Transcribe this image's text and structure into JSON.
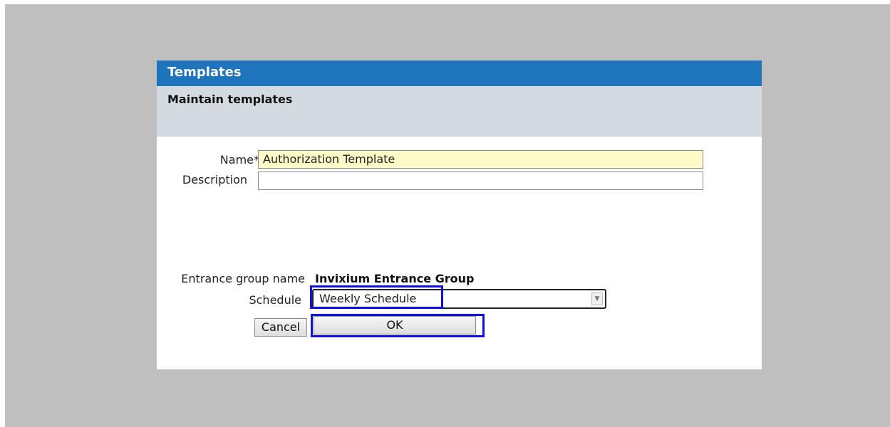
{
  "dialog": {
    "title": "Templates",
    "subtitle": "Maintain templates"
  },
  "form": {
    "name_label": "Name*",
    "name_value": "Authorization Template",
    "description_label": "Description",
    "description_value": "",
    "entrance_group_label": "Entrance group name",
    "entrance_group_value": "Invixium Entrance Group",
    "schedule_label": "Schedule",
    "schedule_value": "Weekly Schedule",
    "schedule_arrow_icon": "dropdown-arrow-icon"
  },
  "buttons": {
    "cancel_label": "Cancel",
    "ok_label": "OK"
  },
  "colors": {
    "titlebar": "#1f74be",
    "subheader": "#d3dbe1",
    "overlay": "#bfbfbf",
    "required_field": "#fffbc8",
    "highlight": "#1010e0"
  }
}
